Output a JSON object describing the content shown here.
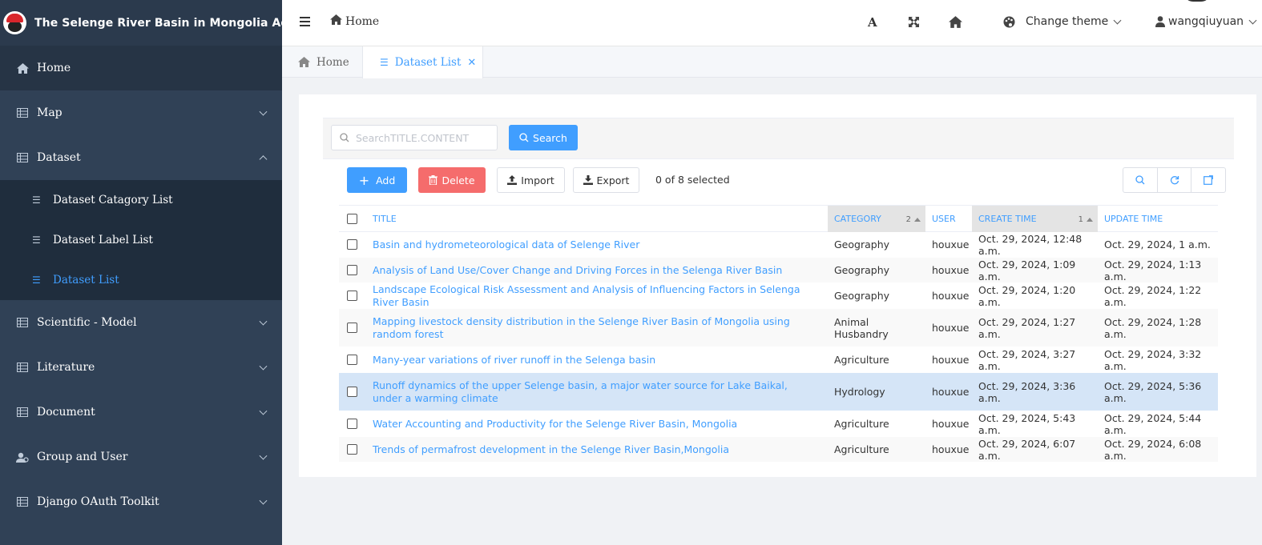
{
  "app": {
    "title": "The Selenge River Basin in Mongolia Admin",
    "logo_icon": "santa-hat-logo"
  },
  "sidebar": {
    "items": [
      {
        "label": "Home",
        "icon": "home-icon"
      },
      {
        "label": "Map",
        "icon": "table-icon"
      },
      {
        "label": "Dataset",
        "icon": "table-icon",
        "expanded": true
      },
      {
        "label": "Scientific - Model",
        "icon": "table-icon"
      },
      {
        "label": "Literature",
        "icon": "table-icon"
      },
      {
        "label": "Document",
        "icon": "table-icon"
      },
      {
        "label": "Group and User",
        "icon": "users-icon"
      },
      {
        "label": "Django OAuth Toolkit",
        "icon": "table-icon"
      }
    ],
    "dataset_sub": [
      {
        "label": "Dataset Catagory List"
      },
      {
        "label": "Dataset Label List"
      },
      {
        "label": "Dataset List",
        "active": true
      }
    ],
    "active_color": "#409eff"
  },
  "header": {
    "breadcrumb": "Home",
    "font_tool": "A",
    "theme_label": "Change theme",
    "username": "wangqiuyuan"
  },
  "tabs": [
    {
      "label": "Home"
    },
    {
      "label": "Dataset List",
      "active": true
    }
  ],
  "search": {
    "placeholder": "SearchTITLE.CONTENT",
    "button_label": "Search"
  },
  "actions": {
    "add_label": "Add",
    "delete_label": "Delete",
    "import_label": "Import",
    "export_label": "Export",
    "selection_text": "0 of 8 selected"
  },
  "table": {
    "headers": {
      "title": "TITLE",
      "category": "CATEGORY",
      "category_sort": "2",
      "user": "USER",
      "create_time": "CREATE TIME",
      "create_time_sort": "1",
      "update_time": "UPDATE TIME"
    },
    "rows": [
      {
        "title": "Basin and hydrometeorological data of Selenge River",
        "category": "Geography",
        "user": "houxue",
        "create_time": "Oct. 29, 2024, 12:48 a.m.",
        "update_time": "Oct. 29, 2024, 1 a.m."
      },
      {
        "title": "Analysis of Land Use/Cover Change and Driving Forces in the Selenga River Basin",
        "category": "Geography",
        "user": "houxue",
        "create_time": "Oct. 29, 2024, 1:09 a.m.",
        "update_time": "Oct. 29, 2024, 1:13 a.m."
      },
      {
        "title": "Landscape Ecological Risk Assessment and Analysis of Influencing Factors in Selenga River Basin",
        "category": "Geography",
        "user": "houxue",
        "create_time": "Oct. 29, 2024, 1:20 a.m.",
        "update_time": "Oct. 29, 2024, 1:22 a.m."
      },
      {
        "title": "Mapping livestock density distribution in the Selenge River Basin of Mongolia using random forest",
        "category": "Animal Husbandry",
        "user": "houxue",
        "create_time": "Oct. 29, 2024, 1:27 a.m.",
        "update_time": "Oct. 29, 2024, 1:28 a.m."
      },
      {
        "title": "Many-year variations of river runoff in the Selenga basin",
        "category": "Agriculture",
        "user": "houxue",
        "create_time": "Oct. 29, 2024, 3:27 a.m.",
        "update_time": "Oct. 29, 2024, 3:32 a.m."
      },
      {
        "title": "Runoff dynamics of the upper Selenge basin, a major water source for Lake Baikal, under a warming climate",
        "category": "Hydrology",
        "user": "houxue",
        "create_time": "Oct. 29, 2024, 3:36 a.m.",
        "update_time": "Oct. 29, 2024, 5:36 a.m."
      },
      {
        "title": "Water Accounting and Productivity for the Selenge River Basin, Mongolia",
        "category": "Agriculture",
        "user": "houxue",
        "create_time": "Oct. 29, 2024, 5:43 a.m.",
        "update_time": "Oct. 29, 2024, 5:44 a.m."
      },
      {
        "title": "Trends of permafrost development in the Selenge River Basin,Mongolia",
        "category": "Agriculture",
        "user": "houxue",
        "create_time": "Oct. 29, 2024, 6:07 a.m.",
        "update_time": "Oct. 29, 2024, 6:08 a.m."
      }
    ]
  }
}
